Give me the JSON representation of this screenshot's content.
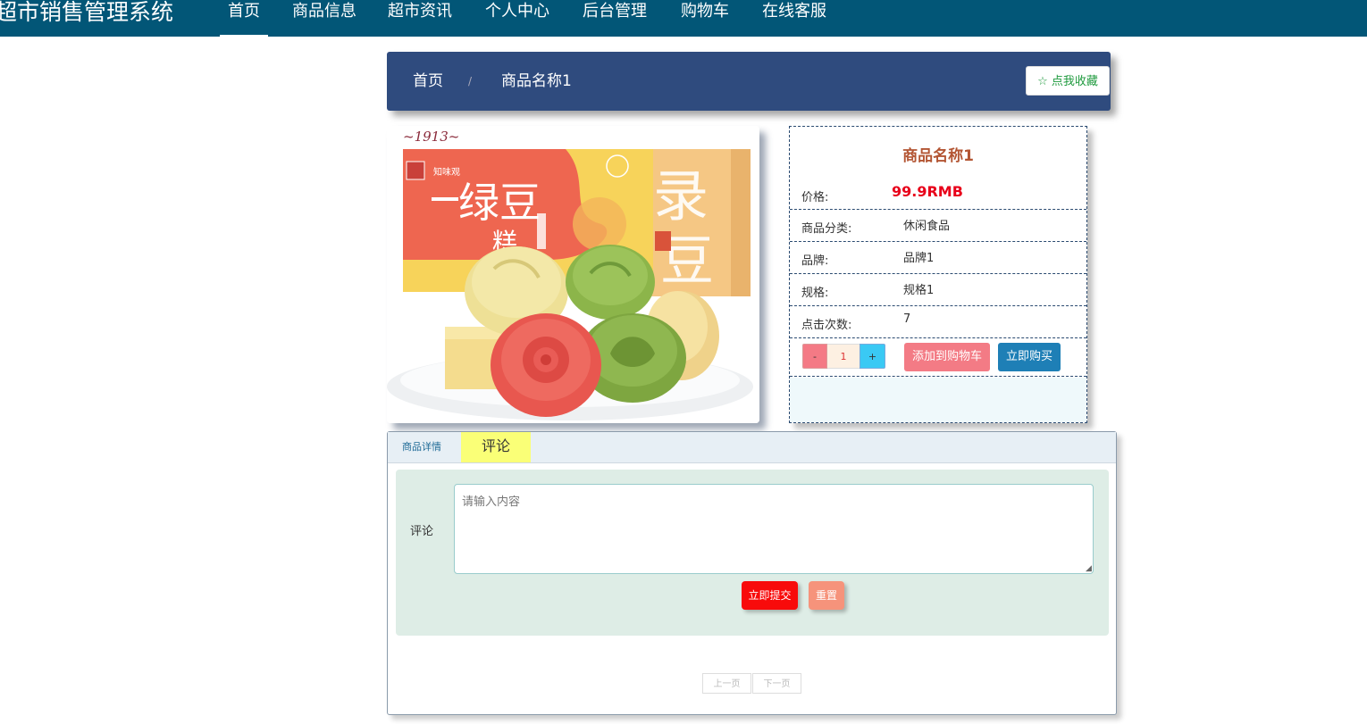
{
  "app": {
    "title": "超市销售管理系统"
  },
  "nav": {
    "items": [
      "首页",
      "商品信息",
      "超市资讯",
      "个人中心",
      "后台管理",
      "购物车",
      "在线客服"
    ],
    "active": "首页"
  },
  "breadcrumb": {
    "home": "首页",
    "separator": "/",
    "current": "商品名称1",
    "favorite_label": "☆ 点我收藏"
  },
  "product": {
    "image_text": {
      "year": "~1913~",
      "big_char_left": "绿豆",
      "big_char_right": "糕"
    },
    "name": "商品名称1",
    "price_label": "价格:",
    "price": "99.9RMB",
    "fields": [
      {
        "label": "商品分类:",
        "value": "休闲食品"
      },
      {
        "label": "品牌:",
        "value": "品牌1"
      },
      {
        "label": "规格:",
        "value": "规格1"
      },
      {
        "label": "点击次数:",
        "value": "7"
      }
    ],
    "quantity": {
      "minus": "-",
      "value": "1",
      "plus": "+"
    },
    "add_to_cart": "添加到购物车",
    "buy_now": "立即购买"
  },
  "tabs": {
    "detail": "商品详情",
    "comment": "评论",
    "active": "评论"
  },
  "comment_form": {
    "label": "评论",
    "placeholder": "请输入内容",
    "submit": "立即提交",
    "reset": "重置"
  },
  "pager": {
    "prev": "上一页",
    "next": "下一页"
  },
  "colors": {
    "nav_bg": "#025677",
    "crumb_bg": "#2f4b7e",
    "price": "#e8001a",
    "title": "#b35533",
    "cart_btn": "#f37b85",
    "buy_btn": "#1e7fb6",
    "submit_btn": "#f80b0b",
    "reset_btn": "#f6937b",
    "active_tab": "#faff77"
  }
}
